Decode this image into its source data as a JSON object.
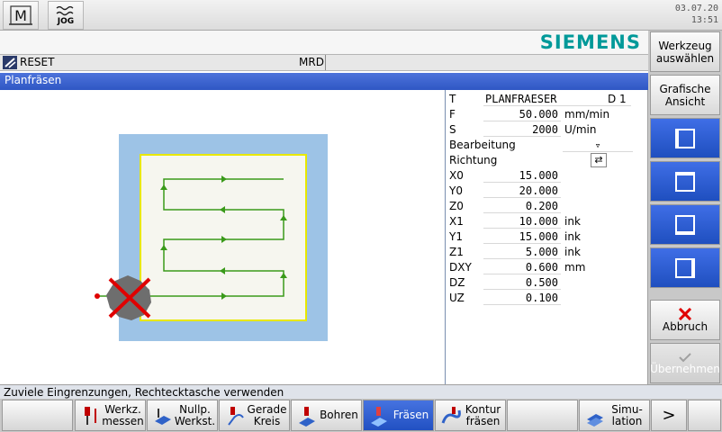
{
  "topbar": {
    "mode_icon_label": "M",
    "jog_label": "JOG",
    "date": "03.07.20",
    "time": "13:51"
  },
  "brand": "SIEMENS",
  "status": {
    "reset": "RESET",
    "mrd": "MRD"
  },
  "header": {
    "title": "Planfräsen"
  },
  "params": {
    "T": {
      "label": "T",
      "value": "PLANFRAESER",
      "suffix": "D 1"
    },
    "F": {
      "label": "F",
      "value": "50.000",
      "unit": "mm/min"
    },
    "S": {
      "label": "S",
      "value": "2000",
      "unit": "U/min"
    },
    "bearbeitung": {
      "label": "Bearbeitung",
      "value": "▿"
    },
    "richtung": {
      "label": "Richtung",
      "value": "⇄"
    },
    "X0": {
      "label": "X0",
      "value": "15.000"
    },
    "Y0": {
      "label": "Y0",
      "value": "20.000"
    },
    "Z0": {
      "label": "Z0",
      "value": "0.200"
    },
    "X1": {
      "label": "X1",
      "value": "10.000",
      "unit": "ink"
    },
    "Y1": {
      "label": "Y1",
      "value": "15.000",
      "unit": "ink"
    },
    "Z1": {
      "label": "Z1",
      "value": "5.000",
      "unit": "ink"
    },
    "DXY": {
      "label": "DXY",
      "value": "0.600",
      "unit": "mm"
    },
    "DZ": {
      "label": "DZ",
      "value": "0.500"
    },
    "UZ": {
      "label": "UZ",
      "value": "0.100"
    }
  },
  "right_softkeys": {
    "werkzeug": "Werkzeug auswählen",
    "grafische": "Grafische Ansicht",
    "abbruch": "Abbruch",
    "uebernehmen": "Übernehmen"
  },
  "message": "Zuviele Eingrenzungen, Rechtecktasche verwenden",
  "bottom_softkeys": {
    "werkz_messen": "Werkz. messen",
    "nullp": "Nullp. Werkst.",
    "gerade": "Gerade Kreis",
    "bohren": "Bohren",
    "fraesen": "Fräsen",
    "kontur": "Kontur fräsen",
    "simulation": "Simu- lation",
    "more": ">"
  },
  "colors": {
    "title_blue": "#2f57c4",
    "siemens_teal": "#009999",
    "active_blue": "#2150c2",
    "path_green": "#3a9a1a",
    "workpiece_blue": "#9dc3e6"
  }
}
